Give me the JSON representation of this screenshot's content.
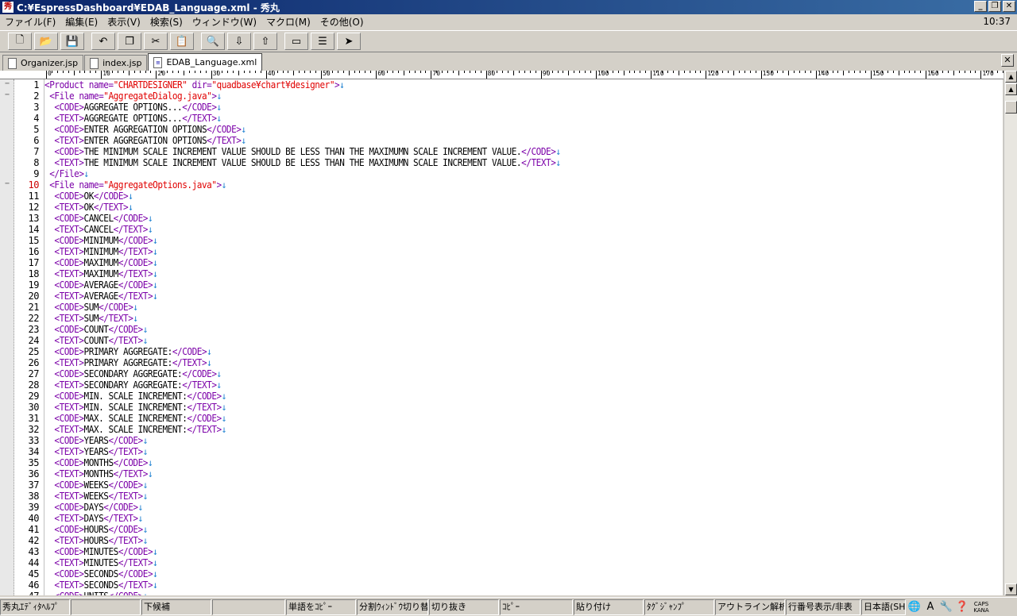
{
  "window": {
    "title": "C:¥EspressDashboard¥EDAB_Language.xml - 秀丸",
    "app_icon": "秀",
    "buttons": [
      "_",
      "❐",
      "✕"
    ]
  },
  "menu": {
    "items": [
      "ファイル(F)",
      "編集(E)",
      "表示(V)",
      "検索(S)",
      "ウィンドウ(W)",
      "マクロ(M)",
      "その他(O)"
    ],
    "clock": "10:37"
  },
  "toolbar": {
    "icons": [
      "new-file-icon",
      "open-folder-icon",
      "save-icon",
      "undo-icon",
      "copy-icon",
      "cut-icon",
      "paste-icon",
      "search-icon",
      "find-down-icon",
      "find-up-icon",
      "grep-icon",
      "split-window-icon",
      "jump-icon"
    ],
    "glyphs": [
      "🗋",
      "📂",
      "💾",
      "↶",
      "❐",
      "✂",
      "📋",
      "🔍",
      "⇩",
      "⇧",
      "▭",
      "☰",
      "➤"
    ]
  },
  "tabs": [
    {
      "label": "Organizer.jsp",
      "active": false
    },
    {
      "label": "index.jsp",
      "active": false
    },
    {
      "label": "EDAB_Language.xml",
      "active": true
    }
  ],
  "ruler_labels": [
    "0",
    "10",
    "20",
    "30",
    "40",
    "50",
    "60",
    "70",
    "80",
    "90",
    "100",
    "110",
    "120",
    "130",
    "140",
    "150",
    "160",
    "170"
  ],
  "editor": {
    "current_line": 10,
    "lines": [
      {
        "n": 1,
        "s": [
          [
            "tg",
            "<"
          ],
          [
            "tn",
            "Product "
          ],
          [
            "at",
            "name="
          ],
          [
            "av",
            "\"CHARTDESIGNER\""
          ],
          [
            "at",
            " dir="
          ],
          [
            "av",
            "\"quadbase¥chart¥designer\""
          ],
          [
            "tg",
            ">"
          ],
          [
            "nl",
            "↓"
          ]
        ]
      },
      {
        "n": 2,
        "s": [
          [
            "tx",
            " "
          ],
          [
            "tg",
            "<File "
          ],
          [
            "at",
            "name="
          ],
          [
            "av",
            "\"AggregateDialog.java\""
          ],
          [
            "tg",
            ">"
          ],
          [
            "nl",
            "↓"
          ]
        ]
      },
      {
        "n": 3,
        "s": [
          [
            "tx",
            "  "
          ],
          [
            "tg",
            "<CODE>"
          ],
          [
            "tx",
            "AGGREGATE OPTIONS..."
          ],
          [
            "tg",
            "</CODE>"
          ],
          [
            "nl",
            "↓"
          ]
        ]
      },
      {
        "n": 4,
        "s": [
          [
            "tx",
            "  "
          ],
          [
            "tg",
            "<TEXT>"
          ],
          [
            "tx",
            "AGGREGATE OPTIONS..."
          ],
          [
            "tg",
            "</TEXT>"
          ],
          [
            "nl",
            "↓"
          ]
        ]
      },
      {
        "n": 5,
        "s": [
          [
            "tx",
            "  "
          ],
          [
            "tg",
            "<CODE>"
          ],
          [
            "tx",
            "ENTER AGGREGATION OPTIONS"
          ],
          [
            "tg",
            "</CODE>"
          ],
          [
            "nl",
            "↓"
          ]
        ]
      },
      {
        "n": 6,
        "s": [
          [
            "tx",
            "  "
          ],
          [
            "tg",
            "<TEXT>"
          ],
          [
            "tx",
            "ENTER AGGREGATION OPTIONS"
          ],
          [
            "tg",
            "</TEXT>"
          ],
          [
            "nl",
            "↓"
          ]
        ]
      },
      {
        "n": 7,
        "s": [
          [
            "tx",
            "  "
          ],
          [
            "tg",
            "<CODE>"
          ],
          [
            "tx",
            "THE MINIMUM SCALE INCREMENT VALUE SHOULD BE LESS THAN THE MAXIMUMN SCALE INCREMENT VALUE."
          ],
          [
            "tg",
            "</CODE>"
          ],
          [
            "nl",
            "↓"
          ]
        ]
      },
      {
        "n": 8,
        "s": [
          [
            "tx",
            "  "
          ],
          [
            "tg",
            "<TEXT>"
          ],
          [
            "tx",
            "THE MINIMUM SCALE INCREMENT VALUE SHOULD BE LESS THAN THE MAXIMUMN SCALE INCREMENT VALUE."
          ],
          [
            "tg",
            "</TEXT>"
          ],
          [
            "nl",
            "↓"
          ]
        ]
      },
      {
        "n": 9,
        "s": [
          [
            "tx",
            " "
          ],
          [
            "tg",
            "</File>"
          ],
          [
            "nl",
            "↓"
          ]
        ]
      },
      {
        "n": 10,
        "s": [
          [
            "tx",
            " "
          ],
          [
            "tg",
            "<File "
          ],
          [
            "at",
            "name="
          ],
          [
            "av",
            "\"AggregateOptions.java\""
          ],
          [
            "tg",
            ">"
          ],
          [
            "nl",
            "↓"
          ]
        ]
      },
      {
        "n": 11,
        "s": [
          [
            "tx",
            "  "
          ],
          [
            "tg",
            "<CODE>"
          ],
          [
            "tx",
            "OK"
          ],
          [
            "tg",
            "</CODE>"
          ],
          [
            "nl",
            "↓"
          ]
        ]
      },
      {
        "n": 12,
        "s": [
          [
            "tx",
            "  "
          ],
          [
            "tg",
            "<TEXT>"
          ],
          [
            "tx",
            "OK"
          ],
          [
            "tg",
            "</TEXT>"
          ],
          [
            "nl",
            "↓"
          ]
        ]
      },
      {
        "n": 13,
        "s": [
          [
            "tx",
            "  "
          ],
          [
            "tg",
            "<CODE>"
          ],
          [
            "tx",
            "CANCEL"
          ],
          [
            "tg",
            "</CODE>"
          ],
          [
            "nl",
            "↓"
          ]
        ]
      },
      {
        "n": 14,
        "s": [
          [
            "tx",
            "  "
          ],
          [
            "tg",
            "<TEXT>"
          ],
          [
            "tx",
            "CANCEL"
          ],
          [
            "tg",
            "</TEXT>"
          ],
          [
            "nl",
            "↓"
          ]
        ]
      },
      {
        "n": 15,
        "s": [
          [
            "tx",
            "  "
          ],
          [
            "tg",
            "<CODE>"
          ],
          [
            "tx",
            "MINIMUM"
          ],
          [
            "tg",
            "</CODE>"
          ],
          [
            "nl",
            "↓"
          ]
        ]
      },
      {
        "n": 16,
        "s": [
          [
            "tx",
            "  "
          ],
          [
            "tg",
            "<TEXT>"
          ],
          [
            "tx",
            "MINIMUM"
          ],
          [
            "tg",
            "</TEXT>"
          ],
          [
            "nl",
            "↓"
          ]
        ]
      },
      {
        "n": 17,
        "s": [
          [
            "tx",
            "  "
          ],
          [
            "tg",
            "<CODE>"
          ],
          [
            "tx",
            "MAXIMUM"
          ],
          [
            "tg",
            "</CODE>"
          ],
          [
            "nl",
            "↓"
          ]
        ]
      },
      {
        "n": 18,
        "s": [
          [
            "tx",
            "  "
          ],
          [
            "tg",
            "<TEXT>"
          ],
          [
            "tx",
            "MAXIMUM"
          ],
          [
            "tg",
            "</TEXT>"
          ],
          [
            "nl",
            "↓"
          ]
        ]
      },
      {
        "n": 19,
        "s": [
          [
            "tx",
            "  "
          ],
          [
            "tg",
            "<CODE>"
          ],
          [
            "tx",
            "AVERAGE"
          ],
          [
            "tg",
            "</CODE>"
          ],
          [
            "nl",
            "↓"
          ]
        ]
      },
      {
        "n": 20,
        "s": [
          [
            "tx",
            "  "
          ],
          [
            "tg",
            "<TEXT>"
          ],
          [
            "tx",
            "AVERAGE"
          ],
          [
            "tg",
            "</TEXT>"
          ],
          [
            "nl",
            "↓"
          ]
        ]
      },
      {
        "n": 21,
        "s": [
          [
            "tx",
            "  "
          ],
          [
            "tg",
            "<CODE>"
          ],
          [
            "tx",
            "SUM"
          ],
          [
            "tg",
            "</CODE>"
          ],
          [
            "nl",
            "↓"
          ]
        ]
      },
      {
        "n": 22,
        "s": [
          [
            "tx",
            "  "
          ],
          [
            "tg",
            "<TEXT>"
          ],
          [
            "tx",
            "SUM"
          ],
          [
            "tg",
            "</TEXT>"
          ],
          [
            "nl",
            "↓"
          ]
        ]
      },
      {
        "n": 23,
        "s": [
          [
            "tx",
            "  "
          ],
          [
            "tg",
            "<CODE>"
          ],
          [
            "tx",
            "COUNT"
          ],
          [
            "tg",
            "</CODE>"
          ],
          [
            "nl",
            "↓"
          ]
        ]
      },
      {
        "n": 24,
        "s": [
          [
            "tx",
            "  "
          ],
          [
            "tg",
            "<TEXT>"
          ],
          [
            "tx",
            "COUNT"
          ],
          [
            "tg",
            "</TEXT>"
          ],
          [
            "nl",
            "↓"
          ]
        ]
      },
      {
        "n": 25,
        "s": [
          [
            "tx",
            "  "
          ],
          [
            "tg",
            "<CODE>"
          ],
          [
            "tx",
            "PRIMARY AGGREGATE:"
          ],
          [
            "tg",
            "</CODE>"
          ],
          [
            "nl",
            "↓"
          ]
        ]
      },
      {
        "n": 26,
        "s": [
          [
            "tx",
            "  "
          ],
          [
            "tg",
            "<TEXT>"
          ],
          [
            "tx",
            "PRIMARY AGGREGATE:"
          ],
          [
            "tg",
            "</TEXT>"
          ],
          [
            "nl",
            "↓"
          ]
        ]
      },
      {
        "n": 27,
        "s": [
          [
            "tx",
            "  "
          ],
          [
            "tg",
            "<CODE>"
          ],
          [
            "tx",
            "SECONDARY AGGREGATE:"
          ],
          [
            "tg",
            "</CODE>"
          ],
          [
            "nl",
            "↓"
          ]
        ]
      },
      {
        "n": 28,
        "s": [
          [
            "tx",
            "  "
          ],
          [
            "tg",
            "<TEXT>"
          ],
          [
            "tx",
            "SECONDARY AGGREGATE:"
          ],
          [
            "tg",
            "</TEXT>"
          ],
          [
            "nl",
            "↓"
          ]
        ]
      },
      {
        "n": 29,
        "s": [
          [
            "tx",
            "  "
          ],
          [
            "tg",
            "<CODE>"
          ],
          [
            "tx",
            "MIN. SCALE INCREMENT:"
          ],
          [
            "tg",
            "</CODE>"
          ],
          [
            "nl",
            "↓"
          ]
        ]
      },
      {
        "n": 30,
        "s": [
          [
            "tx",
            "  "
          ],
          [
            "tg",
            "<TEXT>"
          ],
          [
            "tx",
            "MIN. SCALE INCREMENT:"
          ],
          [
            "tg",
            "</TEXT>"
          ],
          [
            "nl",
            "↓"
          ]
        ]
      },
      {
        "n": 31,
        "s": [
          [
            "tx",
            "  "
          ],
          [
            "tg",
            "<CODE>"
          ],
          [
            "tx",
            "MAX. SCALE INCREMENT:"
          ],
          [
            "tg",
            "</CODE>"
          ],
          [
            "nl",
            "↓"
          ]
        ]
      },
      {
        "n": 32,
        "s": [
          [
            "tx",
            "  "
          ],
          [
            "tg",
            "<TEXT>"
          ],
          [
            "tx",
            "MAX. SCALE INCREMENT:"
          ],
          [
            "tg",
            "</TEXT>"
          ],
          [
            "nl",
            "↓"
          ]
        ]
      },
      {
        "n": 33,
        "s": [
          [
            "tx",
            "  "
          ],
          [
            "tg",
            "<CODE>"
          ],
          [
            "tx",
            "YEARS"
          ],
          [
            "tg",
            "</CODE>"
          ],
          [
            "nl",
            "↓"
          ]
        ]
      },
      {
        "n": 34,
        "s": [
          [
            "tx",
            "  "
          ],
          [
            "tg",
            "<TEXT>"
          ],
          [
            "tx",
            "YEARS"
          ],
          [
            "tg",
            "</TEXT>"
          ],
          [
            "nl",
            "↓"
          ]
        ]
      },
      {
        "n": 35,
        "s": [
          [
            "tx",
            "  "
          ],
          [
            "tg",
            "<CODE>"
          ],
          [
            "tx",
            "MONTHS"
          ],
          [
            "tg",
            "</CODE>"
          ],
          [
            "nl",
            "↓"
          ]
        ]
      },
      {
        "n": 36,
        "s": [
          [
            "tx",
            "  "
          ],
          [
            "tg",
            "<TEXT>"
          ],
          [
            "tx",
            "MONTHS"
          ],
          [
            "tg",
            "</TEXT>"
          ],
          [
            "nl",
            "↓"
          ]
        ]
      },
      {
        "n": 37,
        "s": [
          [
            "tx",
            "  "
          ],
          [
            "tg",
            "<CODE>"
          ],
          [
            "tx",
            "WEEKS"
          ],
          [
            "tg",
            "</CODE>"
          ],
          [
            "nl",
            "↓"
          ]
        ]
      },
      {
        "n": 38,
        "s": [
          [
            "tx",
            "  "
          ],
          [
            "tg",
            "<TEXT>"
          ],
          [
            "tx",
            "WEEKS"
          ],
          [
            "tg",
            "</TEXT>"
          ],
          [
            "nl",
            "↓"
          ]
        ]
      },
      {
        "n": 39,
        "s": [
          [
            "tx",
            "  "
          ],
          [
            "tg",
            "<CODE>"
          ],
          [
            "tx",
            "DAYS"
          ],
          [
            "tg",
            "</CODE>"
          ],
          [
            "nl",
            "↓"
          ]
        ]
      },
      {
        "n": 40,
        "s": [
          [
            "tx",
            "  "
          ],
          [
            "tg",
            "<TEXT>"
          ],
          [
            "tx",
            "DAYS"
          ],
          [
            "tg",
            "</TEXT>"
          ],
          [
            "nl",
            "↓"
          ]
        ]
      },
      {
        "n": 41,
        "s": [
          [
            "tx",
            "  "
          ],
          [
            "tg",
            "<CODE>"
          ],
          [
            "tx",
            "HOURS"
          ],
          [
            "tg",
            "</CODE>"
          ],
          [
            "nl",
            "↓"
          ]
        ]
      },
      {
        "n": 42,
        "s": [
          [
            "tx",
            "  "
          ],
          [
            "tg",
            "<TEXT>"
          ],
          [
            "tx",
            "HOURS"
          ],
          [
            "tg",
            "</TEXT>"
          ],
          [
            "nl",
            "↓"
          ]
        ]
      },
      {
        "n": 43,
        "s": [
          [
            "tx",
            "  "
          ],
          [
            "tg",
            "<CODE>"
          ],
          [
            "tx",
            "MINUTES"
          ],
          [
            "tg",
            "</CODE>"
          ],
          [
            "nl",
            "↓"
          ]
        ]
      },
      {
        "n": 44,
        "s": [
          [
            "tx",
            "  "
          ],
          [
            "tg",
            "<TEXT>"
          ],
          [
            "tx",
            "MINUTES"
          ],
          [
            "tg",
            "</TEXT>"
          ],
          [
            "nl",
            "↓"
          ]
        ]
      },
      {
        "n": 45,
        "s": [
          [
            "tx",
            "  "
          ],
          [
            "tg",
            "<CODE>"
          ],
          [
            "tx",
            "SECONDS"
          ],
          [
            "tg",
            "</CODE>"
          ],
          [
            "nl",
            "↓"
          ]
        ]
      },
      {
        "n": 46,
        "s": [
          [
            "tx",
            "  "
          ],
          [
            "tg",
            "<TEXT>"
          ],
          [
            "tx",
            "SECONDS"
          ],
          [
            "tg",
            "</TEXT>"
          ],
          [
            "nl",
            "↓"
          ]
        ]
      },
      {
        "n": 47,
        "s": [
          [
            "tx",
            "  "
          ],
          [
            "tg",
            "<CODE>"
          ],
          [
            "tx",
            "UNITS"
          ],
          [
            "tg",
            "</CODE>"
          ],
          [
            "nl",
            "↓"
          ]
        ]
      }
    ]
  },
  "statusbar": {
    "panels": [
      "秀丸ｴﾃﾞｨﾀﾍﾙﾌﾟ",
      "",
      "下候補",
      "",
      "単語をｺﾋﾟｰ",
      "分割ｳｨﾝﾄﾞｳ切り替",
      "切り抜き",
      "ｺﾋﾟｰ",
      "貼り付け",
      "ﾀｸﾞｼﾞｬﾝﾌﾟ",
      "アウトライン解析...",
      "行番号表示/非表",
      "日本語(SH"
    ],
    "caps": "CAPS",
    "kana": "KANA"
  },
  "colors": {
    "tag": "#7b00a8",
    "attr_value": "#e00000",
    "newline": "#1a7fd0",
    "current_line_number": "#cc0000"
  }
}
